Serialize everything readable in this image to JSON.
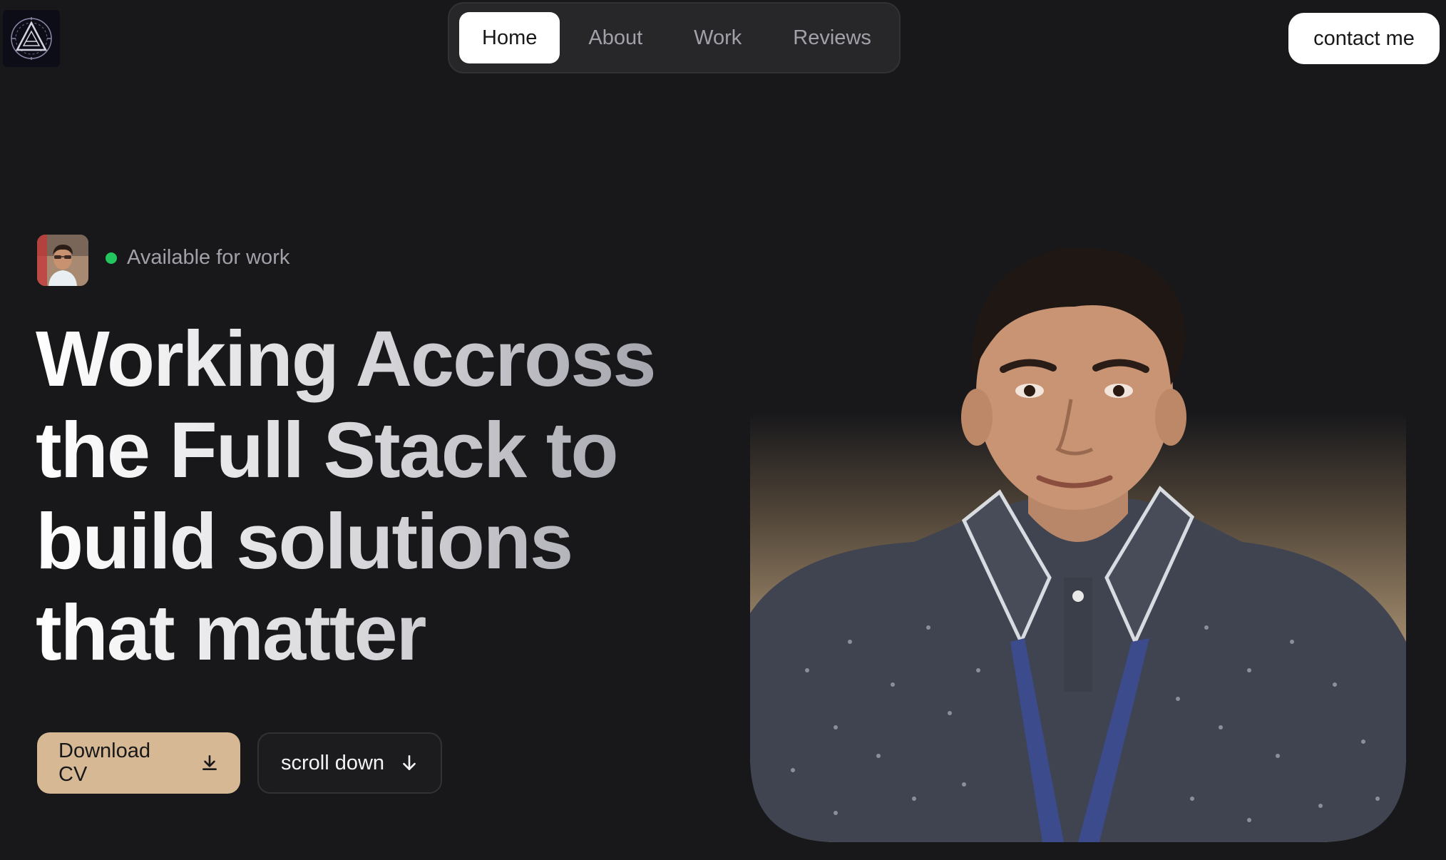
{
  "header": {
    "logo_icon": "geometric-triangle-logo-icon",
    "nav": [
      {
        "label": "Home",
        "active": true
      },
      {
        "label": "About",
        "active": false
      },
      {
        "label": "Work",
        "active": false
      },
      {
        "label": "Reviews",
        "active": false
      }
    ],
    "contact_label": "contact me"
  },
  "hero": {
    "avatar_icon": "profile-avatar-image",
    "status_text": "Available for work",
    "status_color": "#22c55e",
    "headline": "Working Accross the Full Stack to build solutions that matter",
    "buttons": {
      "download_label": "Download CV",
      "download_icon": "download-icon",
      "scroll_label": "scroll down",
      "scroll_icon": "arrow-down-icon"
    },
    "portrait_icon": "portrait-photo"
  },
  "colors": {
    "background": "#18181b",
    "accent": "#d6b894",
    "nav_bg": "#27272a"
  }
}
